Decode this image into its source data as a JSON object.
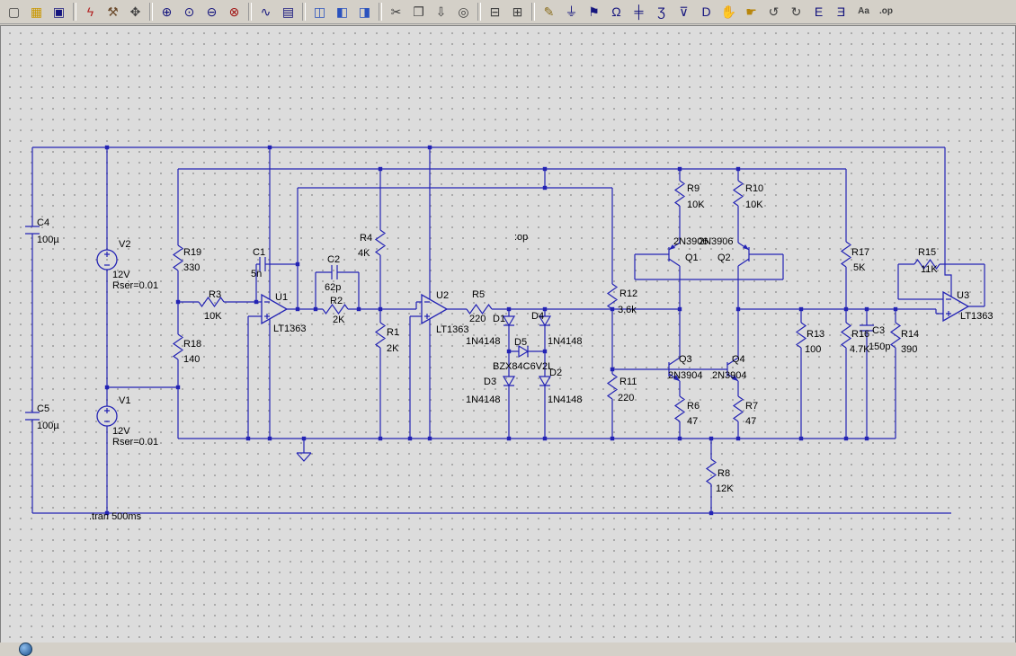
{
  "canvas": {
    "bg": "#dcdcdc",
    "grid_dot": "#a6a6a6",
    "wire_color": "#2323b4",
    "text_color": "#000000"
  },
  "toolbar": {
    "groups": [
      [
        {
          "name": "new-schematic",
          "glyph": "▢",
          "color": "#404040"
        },
        {
          "name": "open",
          "glyph": "▦",
          "color": "#c99700"
        },
        {
          "name": "save",
          "glyph": "▣",
          "color": "#15157e"
        }
      ],
      [
        {
          "name": "run",
          "glyph": "ϟ",
          "color": "#b22222"
        },
        {
          "name": "control-panel",
          "glyph": "⚒",
          "color": "#6b4a2b"
        },
        {
          "name": "pan",
          "glyph": "✥",
          "color": "#404040"
        }
      ],
      [
        {
          "name": "zoom-in",
          "glyph": "⊕",
          "color": "#15157e"
        },
        {
          "name": "zoom-area",
          "glyph": "⊙",
          "color": "#15157e"
        },
        {
          "name": "zoom-out",
          "glyph": "⊖",
          "color": "#15157e"
        },
        {
          "name": "zoom-full-extents",
          "glyph": "⊗",
          "color": "#a01010"
        }
      ],
      [
        {
          "name": "waveform",
          "glyph": "∿",
          "color": "#15157e"
        },
        {
          "name": "plot-settings",
          "glyph": "▤",
          "color": "#15157e"
        }
      ],
      [
        {
          "name": "tile-horizontal",
          "glyph": "◫",
          "color": "#2a52be"
        },
        {
          "name": "tile-vertical",
          "glyph": "◧",
          "color": "#2a52be"
        },
        {
          "name": "cascade-windows",
          "glyph": "◨",
          "color": "#2a52be"
        }
      ],
      [
        {
          "name": "cut",
          "glyph": "✂",
          "color": "#404040"
        },
        {
          "name": "copy",
          "glyph": "❐",
          "color": "#404040"
        },
        {
          "name": "paste",
          "glyph": "⇩",
          "color": "#404040"
        },
        {
          "name": "find",
          "glyph": "◎",
          "color": "#404040"
        }
      ],
      [
        {
          "name": "print",
          "glyph": "⊟",
          "color": "#404040"
        },
        {
          "name": "print-preview",
          "glyph": "⊞",
          "color": "#404040"
        }
      ],
      [
        {
          "name": "wire",
          "glyph": "✎",
          "color": "#8a6d1c"
        },
        {
          "name": "ground",
          "glyph": "⏚",
          "color": "#15157e"
        },
        {
          "name": "label-net",
          "glyph": "⚑",
          "color": "#15157e"
        },
        {
          "name": "resistor",
          "glyph": "Ω",
          "color": "#15157e"
        },
        {
          "name": "capacitor",
          "glyph": "╪",
          "color": "#15157e"
        },
        {
          "name": "inductor",
          "glyph": "Ʒ",
          "color": "#15157e"
        },
        {
          "name": "diode",
          "glyph": "⊽",
          "color": "#15157e"
        },
        {
          "name": "component",
          "glyph": "D",
          "color": "#15157e"
        },
        {
          "name": "move",
          "glyph": "✋",
          "color": "#b8860b"
        },
        {
          "name": "drag",
          "glyph": "☛",
          "color": "#b8860b"
        },
        {
          "name": "undo",
          "glyph": "↺",
          "color": "#404040"
        },
        {
          "name": "redo",
          "glyph": "↻",
          "color": "#404040"
        },
        {
          "name": "rotate",
          "glyph": "E",
          "color": "#15157e"
        },
        {
          "name": "mirror",
          "glyph": "Ǝ",
          "color": "#15157e"
        },
        {
          "name": "text",
          "glyph": "Aa",
          "color": "#404040"
        },
        {
          "name": "spice-directive",
          "glyph": ".op",
          "color": "#404040"
        }
      ]
    ]
  },
  "components": {
    "C4": {
      "ref": "C4",
      "value": "100µ"
    },
    "C5": {
      "ref": "C5",
      "value": "100µ"
    },
    "V2": {
      "ref": "V2",
      "value": "12V",
      "extra": "Rser=0.01"
    },
    "V1": {
      "ref": "V1",
      "value": "12V",
      "extra": "Rser=0.01"
    },
    "R19": {
      "ref": "R19",
      "value": "330"
    },
    "R18": {
      "ref": "R18",
      "value": "140"
    },
    "R3": {
      "ref": "R3",
      "value": "10K"
    },
    "C1": {
      "ref": "C1",
      "value": "5n"
    },
    "U1": {
      "ref": "U1",
      "value": "LT1363"
    },
    "C2": {
      "ref": "C2",
      "value": "62p"
    },
    "R2": {
      "ref": "R2",
      "value": "2K"
    },
    "R4": {
      "ref": "R4",
      "value": "4K"
    },
    "R1": {
      "ref": "R1",
      "value": "2K"
    },
    "U2": {
      "ref": "U2",
      "value": "LT1363"
    },
    "R5": {
      "ref": "R5",
      "value": "220"
    },
    "D1": {
      "ref": "D1",
      "value": "1N4148"
    },
    "D4": {
      "ref": "D4",
      "value": "1N4148"
    },
    "D5": {
      "ref": "D5",
      "value": "BZX84C6V2L"
    },
    "D3": {
      "ref": "D3",
      "value": "1N4148"
    },
    "D2": {
      "ref": "D2",
      "value": "1N4148"
    },
    "R12": {
      "ref": "R12",
      "value": "3.6k"
    },
    "R11": {
      "ref": "R11",
      "value": "220"
    },
    "R9": {
      "ref": "R9",
      "value": "10K"
    },
    "R10": {
      "ref": "R10",
      "value": "10K"
    },
    "Q1": {
      "ref": "Q1",
      "value": "2N3906"
    },
    "Q2": {
      "ref": "Q2",
      "value": "2N3906"
    },
    "Q3": {
      "ref": "Q3",
      "value": "2N3904"
    },
    "Q4": {
      "ref": "Q4",
      "value": "2N3904"
    },
    "R6": {
      "ref": "R6",
      "value": "47"
    },
    "R7": {
      "ref": "R7",
      "value": "47"
    },
    "R8": {
      "ref": "R8",
      "value": "12K"
    },
    "R13": {
      "ref": "R13",
      "value": "100"
    },
    "R17": {
      "ref": "R17",
      "value": "5K"
    },
    "R16": {
      "ref": "R16",
      "value": "4.7K"
    },
    "C3": {
      "ref": "C3",
      "value": "150p"
    },
    "R14": {
      "ref": "R14",
      "value": "390"
    },
    "R15": {
      "ref": "R15",
      "value": "11K"
    },
    "U3": {
      "ref": "U3",
      "value": "LT1363"
    }
  },
  "directives": {
    "op": ":op",
    "tran": ".tran 500ms"
  },
  "statusbar": {
    "icon": "app-logo"
  }
}
